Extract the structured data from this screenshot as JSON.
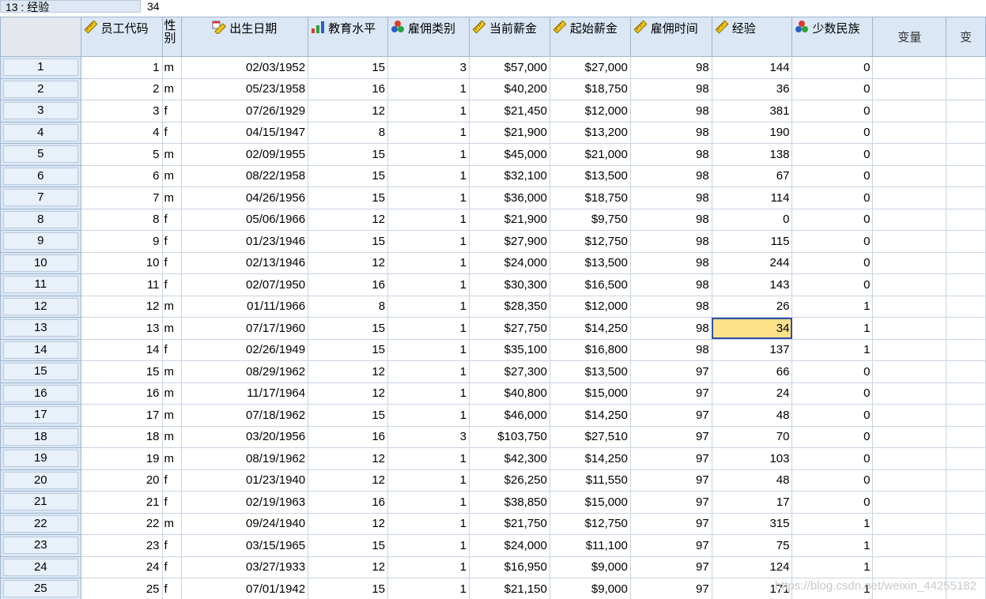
{
  "cell_ref": "13 : 经验",
  "cell_value": "34",
  "columns": [
    {
      "label": "员工代码",
      "icon": "scale-ruler-icon"
    },
    {
      "label": "性别",
      "icon": ""
    },
    {
      "label": "出生日期",
      "icon": "date-ruler-icon"
    },
    {
      "label": "教育水平",
      "icon": "ordinal-bar-icon"
    },
    {
      "label": "雇佣类别",
      "icon": "nominal-circles-icon"
    },
    {
      "label": "当前薪金",
      "icon": "scale-ruler-icon"
    },
    {
      "label": "起始薪金",
      "icon": "scale-ruler-icon"
    },
    {
      "label": "雇佣时间",
      "icon": "scale-ruler-icon"
    },
    {
      "label": "经验",
      "icon": "scale-ruler-icon"
    },
    {
      "label": "少数民族",
      "icon": "nominal-circles-icon"
    },
    {
      "label": "变量",
      "icon": ""
    },
    {
      "label": "变",
      "icon": ""
    }
  ],
  "rows": [
    [
      "1",
      "1",
      "m",
      "02/03/1952",
      "15",
      "3",
      "$57,000",
      "$27,000",
      "98",
      "144",
      "0"
    ],
    [
      "2",
      "2",
      "m",
      "05/23/1958",
      "16",
      "1",
      "$40,200",
      "$18,750",
      "98",
      "36",
      "0"
    ],
    [
      "3",
      "3",
      "f",
      "07/26/1929",
      "12",
      "1",
      "$21,450",
      "$12,000",
      "98",
      "381",
      "0"
    ],
    [
      "4",
      "4",
      "f",
      "04/15/1947",
      "8",
      "1",
      "$21,900",
      "$13,200",
      "98",
      "190",
      "0"
    ],
    [
      "5",
      "5",
      "m",
      "02/09/1955",
      "15",
      "1",
      "$45,000",
      "$21,000",
      "98",
      "138",
      "0"
    ],
    [
      "6",
      "6",
      "m",
      "08/22/1958",
      "15",
      "1",
      "$32,100",
      "$13,500",
      "98",
      "67",
      "0"
    ],
    [
      "7",
      "7",
      "m",
      "04/26/1956",
      "15",
      "1",
      "$36,000",
      "$18,750",
      "98",
      "114",
      "0"
    ],
    [
      "8",
      "8",
      "f",
      "05/06/1966",
      "12",
      "1",
      "$21,900",
      "$9,750",
      "98",
      "0",
      "0"
    ],
    [
      "9",
      "9",
      "f",
      "01/23/1946",
      "15",
      "1",
      "$27,900",
      "$12,750",
      "98",
      "115",
      "0"
    ],
    [
      "10",
      "10",
      "f",
      "02/13/1946",
      "12",
      "1",
      "$24,000",
      "$13,500",
      "98",
      "244",
      "0"
    ],
    [
      "11",
      "11",
      "f",
      "02/07/1950",
      "16",
      "1",
      "$30,300",
      "$16,500",
      "98",
      "143",
      "0"
    ],
    [
      "12",
      "12",
      "m",
      "01/11/1966",
      "8",
      "1",
      "$28,350",
      "$12,000",
      "98",
      "26",
      "1"
    ],
    [
      "13",
      "13",
      "m",
      "07/17/1960",
      "15",
      "1",
      "$27,750",
      "$14,250",
      "98",
      "34",
      "1"
    ],
    [
      "14",
      "14",
      "f",
      "02/26/1949",
      "15",
      "1",
      "$35,100",
      "$16,800",
      "98",
      "137",
      "1"
    ],
    [
      "15",
      "15",
      "m",
      "08/29/1962",
      "12",
      "1",
      "$27,300",
      "$13,500",
      "97",
      "66",
      "0"
    ],
    [
      "16",
      "16",
      "m",
      "11/17/1964",
      "12",
      "1",
      "$40,800",
      "$15,000",
      "97",
      "24",
      "0"
    ],
    [
      "17",
      "17",
      "m",
      "07/18/1962",
      "15",
      "1",
      "$46,000",
      "$14,250",
      "97",
      "48",
      "0"
    ],
    [
      "18",
      "18",
      "m",
      "03/20/1956",
      "16",
      "3",
      "$103,750",
      "$27,510",
      "97",
      "70",
      "0"
    ],
    [
      "19",
      "19",
      "m",
      "08/19/1962",
      "12",
      "1",
      "$42,300",
      "$14,250",
      "97",
      "103",
      "0"
    ],
    [
      "20",
      "20",
      "f",
      "01/23/1940",
      "12",
      "1",
      "$26,250",
      "$11,550",
      "97",
      "48",
      "0"
    ],
    [
      "21",
      "21",
      "f",
      "02/19/1963",
      "16",
      "1",
      "$38,850",
      "$15,000",
      "97",
      "17",
      "0"
    ],
    [
      "22",
      "22",
      "m",
      "09/24/1940",
      "12",
      "1",
      "$21,750",
      "$12,750",
      "97",
      "315",
      "1"
    ],
    [
      "23",
      "23",
      "f",
      "03/15/1965",
      "15",
      "1",
      "$24,000",
      "$11,100",
      "97",
      "75",
      "1"
    ],
    [
      "24",
      "24",
      "f",
      "03/27/1933",
      "12",
      "1",
      "$16,950",
      "$9,000",
      "97",
      "124",
      "1"
    ],
    [
      "25",
      "25",
      "f",
      "07/01/1942",
      "15",
      "1",
      "$21,150",
      "$9,000",
      "97",
      "171",
      "1"
    ]
  ],
  "selected_cell": {
    "row": "13",
    "column": "经验"
  },
  "watermark": "https://blog.csdn.net/weixin_44255182",
  "colors": {
    "header_bg": "#dbe7f5",
    "selected_cell_bg": "#fde28a",
    "selected_cell_border": "#2d4fa8"
  }
}
